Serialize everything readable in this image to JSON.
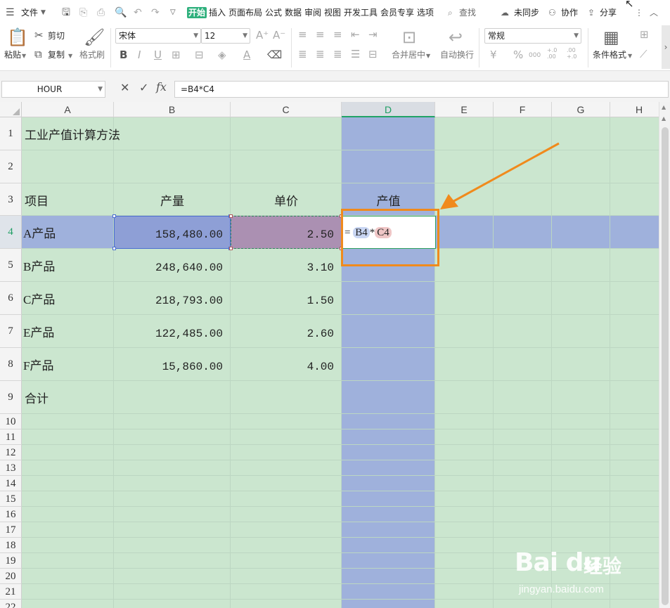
{
  "menubar": {
    "hamburger_icon": "menu-icon",
    "file_label": "文件",
    "tabs": [
      "开始",
      "插入",
      "页面布局",
      "公式",
      "数据",
      "审阅",
      "视图",
      "开发工具",
      "会员专享",
      "选项"
    ],
    "search_label": "查找",
    "sync_label": "未同步",
    "collab_label": "协作",
    "share_label": "分享"
  },
  "ribbon": {
    "paste_label": "粘贴",
    "cut_label": "剪切",
    "copy_label": "复制",
    "format_painter_label": "格式刷",
    "font_name": "宋体",
    "font_size": "12",
    "merge_center_label": "合并居中",
    "auto_wrap_label": "自动换行",
    "number_format": "常规",
    "conditional_format_label": "条件格式",
    "currency_symbol": "¥",
    "percent_symbol": "%",
    "thousands_symbol": "000",
    "inc_decimal_symbol": "+.0 .00",
    "dec_decimal_symbol": ".00 +.0"
  },
  "formula_bar": {
    "name_box": "HOUR",
    "fx_label": "fx",
    "formula": "=B4*C4"
  },
  "sheet": {
    "columns": [
      "A",
      "B",
      "C",
      "D",
      "E",
      "F",
      "G",
      "H"
    ],
    "selected_column": "D",
    "rows": [
      "1",
      "2",
      "3",
      "4",
      "5",
      "6",
      "7",
      "8",
      "9",
      "10",
      "11",
      "12",
      "13",
      "14",
      "15",
      "16",
      "17",
      "18",
      "19",
      "20",
      "21",
      "22"
    ],
    "selected_row": "4",
    "title": "工业产值计算方法",
    "headers": {
      "item": "项目",
      "output": "产量",
      "price": "单价",
      "value": "产值"
    },
    "data": [
      {
        "item": "A产品",
        "output": "158,480.00",
        "price": "2.50"
      },
      {
        "item": "B产品",
        "output": "248,640.00",
        "price": "3.10"
      },
      {
        "item": "C产品",
        "output": "218,793.00",
        "price": "1.50"
      },
      {
        "item": "E产品",
        "output": "122,485.00",
        "price": "2.60"
      },
      {
        "item": "F产品",
        "output": "15,860.00",
        "price": "4.00"
      }
    ],
    "total_label": "合计",
    "edit_cell": {
      "eq": "=",
      "ref1": "B4",
      "op": "*",
      "ref2": "C4"
    }
  },
  "annotation": {
    "color": "#f08a1c"
  },
  "watermark": {
    "logo": "Bai du",
    "brand": "经验",
    "url": "jingyan.baidu.com"
  },
  "colors": {
    "grid_fill": "#cbe6cf",
    "selection_fill": "#9fb1dc",
    "accent": "#2fb07d",
    "highlight": "#f08a1c"
  }
}
